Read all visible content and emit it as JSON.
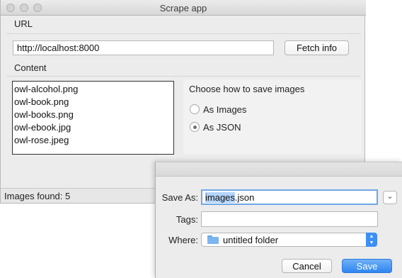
{
  "window": {
    "title": "Scrape app"
  },
  "url_section": {
    "label": "URL",
    "url_value": "http://localhost:8000",
    "fetch_button": "Fetch info"
  },
  "content_section": {
    "label": "Content",
    "files": [
      "owl-alcohol.png",
      "owl-book.png",
      "owl-books.png",
      "owl-ebook.jpg",
      "owl-rose.jpeg"
    ]
  },
  "save_options": {
    "heading": "Choose how to save images",
    "options": [
      {
        "label": "As Images",
        "selected": false
      },
      {
        "label": "As JSON",
        "selected": true
      }
    ]
  },
  "status": {
    "text": "Images found: 5"
  },
  "save_dialog": {
    "save_as_label": "Save As:",
    "filename_base": "images",
    "filename_ext": ".json",
    "tags_label": "Tags:",
    "tags_value": "",
    "where_label": "Where:",
    "where_value": "untitled folder",
    "expand_icon": "chevron-down-icon",
    "folder_icon": "folder-icon",
    "cancel_button": "Cancel",
    "save_button": "Save",
    "accent": "#3d8ef5"
  }
}
